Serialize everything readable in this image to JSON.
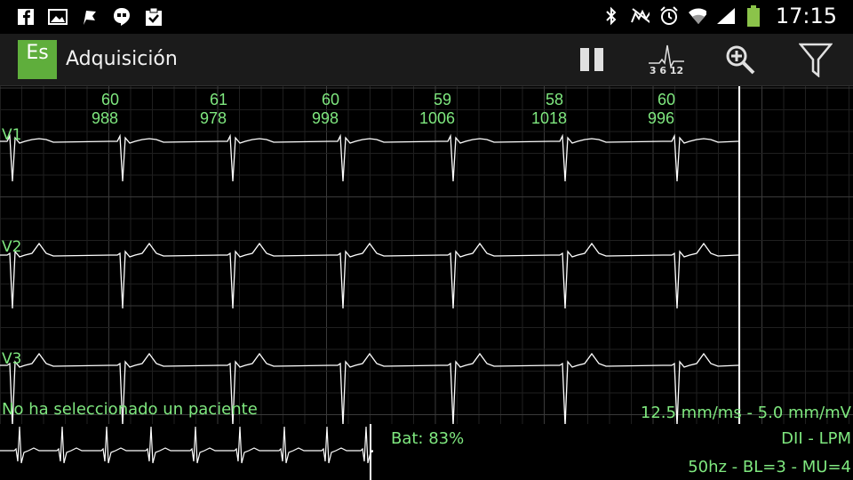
{
  "status_bar": {
    "left_icons": [
      "facebook-icon",
      "image-icon",
      "flag-icon",
      "hangouts-icon",
      "clipboard-check-icon"
    ],
    "right_icons": [
      "bluetooth-icon",
      "mute-icon",
      "alarm-icon",
      "wifi-icon",
      "signal-icon",
      "battery-icon"
    ],
    "time": "17:15"
  },
  "action_bar": {
    "app_icon_text": "Es",
    "title": "Adquisición",
    "actions": [
      {
        "name": "pause-icon",
        "label": ""
      },
      {
        "name": "leads-icon",
        "label": "3 6 12"
      },
      {
        "name": "zoom-in-icon",
        "label": ""
      },
      {
        "name": "filter-icon",
        "label": ""
      }
    ]
  },
  "ecg": {
    "beats": [
      {
        "bpm": "60",
        "rr": "988"
      },
      {
        "bpm": "61",
        "rr": "978"
      },
      {
        "bpm": "60",
        "rr": "998"
      },
      {
        "bpm": "59",
        "rr": "1006"
      },
      {
        "bpm": "58",
        "rr": "1018"
      },
      {
        "bpm": "60",
        "rr": "996"
      }
    ],
    "leads": [
      "V1",
      "V2",
      "V3"
    ],
    "patient_message": "No ha seleccionado un paciente",
    "scale": "12.5 mm/ms - 5.0 mm/mV"
  },
  "footer": {
    "battery": "Bat: 83%",
    "lead_info": "DII -  LPM",
    "filter_info": "50hz - BL=3 - MU=4"
  },
  "colors": {
    "trace": "#ffffff",
    "text_green": "#7fe87f",
    "grid_minor": "#1f1f1f",
    "grid_major": "#3a3a3a",
    "app_icon": "#5fae3c"
  }
}
